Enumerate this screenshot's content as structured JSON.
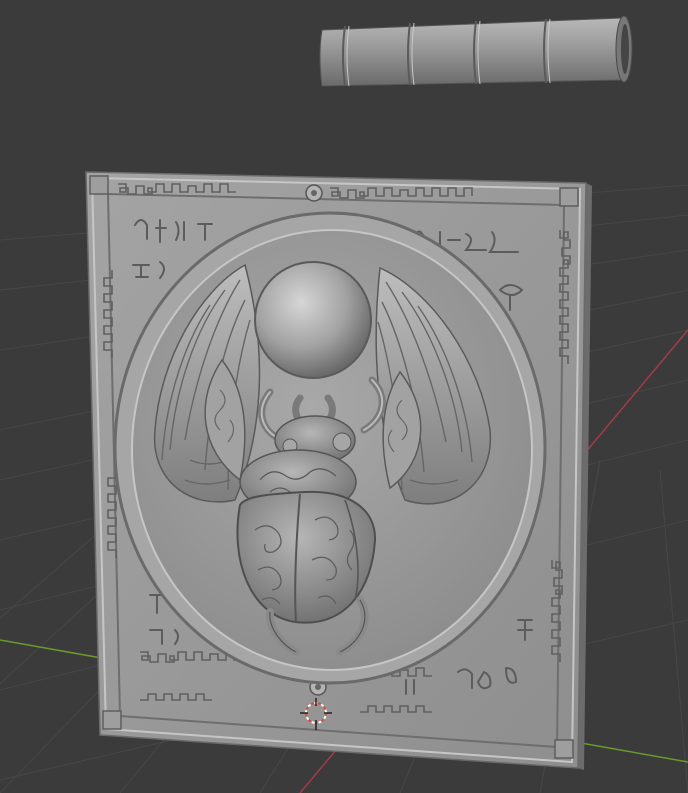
{
  "viewport": {
    "background": "#3b3b3b",
    "grid_color": "#4a4a4a",
    "x_axis_color": "#a33b4a",
    "y_axis_color": "#6a9a2a"
  },
  "objects": [
    {
      "name": "ribbed-cylinder",
      "selected": false
    },
    {
      "name": "scarab-relief-panel",
      "selected": false
    }
  ],
  "gizmo": {
    "name": "3d-cursor-icon"
  },
  "panel_colors": {
    "base": "#9a9a9a",
    "light": "#c4c4c4",
    "mid": "#8c8c8c",
    "dark": "#5e5e5e"
  }
}
